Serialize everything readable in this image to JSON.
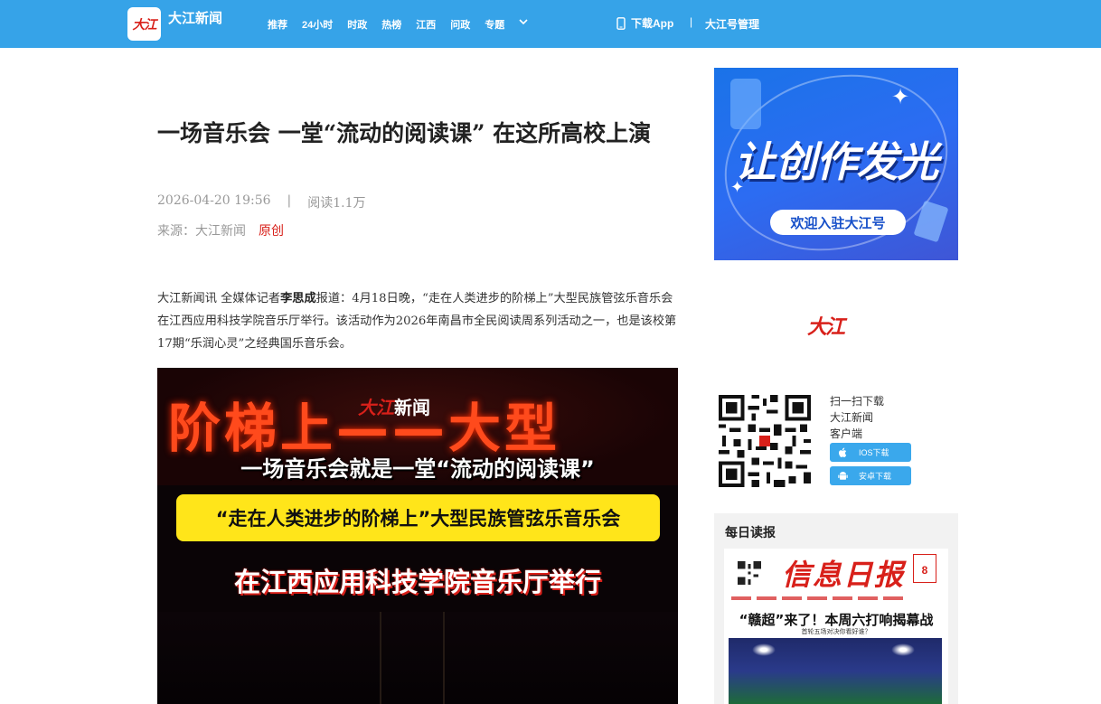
{
  "header": {
    "logo_text": "大江",
    "brand": "大江新闻",
    "nav": [
      "推荐",
      "24小时",
      "时政",
      "热榜",
      "江西",
      "问政",
      "专题"
    ],
    "download_app": "下载App",
    "separator": "|",
    "account_manage": "大江号管理"
  },
  "article": {
    "title": "一场音乐会  一堂“流动的阅读课”  在这所高校上演",
    "date": "2026-04-20 19:56",
    "meta_sep": "|",
    "reads": "阅读1.1万",
    "source_label": "来源：大江新闻",
    "original_tag": "原创",
    "body_prefix": "大江新闻讯  全媒体记者",
    "reporter": "李思成",
    "body_rest": "报道：4月18日晚，“走在人类进步的阶梯上”大型民族管弦乐音乐会在江西应用科技学院音乐厅举行。该活动作为2026年南昌市全民阅读周系列活动之一，也是该校第17期“乐润心灵”之经典国乐音乐会。"
  },
  "article_image": {
    "led_text": "阶梯上——大型",
    "logo_mark": "大江",
    "logo_word": "新闻",
    "line1": "一场音乐会就是一堂“流动的阅读课”",
    "line2": "“走在人类进步的阶梯上”大型民族管弦乐音乐会",
    "line3": "在江西应用科技学院音乐厅举行"
  },
  "sidebar": {
    "promo_title": "让创作发光",
    "promo_button": "欢迎入驻大江号",
    "logo_text": "大江",
    "qr_lines": [
      "扫一扫下载",
      "大江新闻",
      "客户端"
    ],
    "ios_label": "IOS下载",
    "android_label": "安卓下载",
    "daily_title": "每日读报",
    "paper_masthead": "信息日报",
    "paper_date_num": "8",
    "paper_headline": "“赣超”来了！本周六打响揭幕战",
    "paper_subhead": "首轮五场对决你看好谁？"
  },
  "colors": {
    "header_bg": "#36a3e8",
    "accent_red": "#d8201a",
    "promo_blue": "#1a73e8",
    "band_yellow": "#ffe51a"
  }
}
